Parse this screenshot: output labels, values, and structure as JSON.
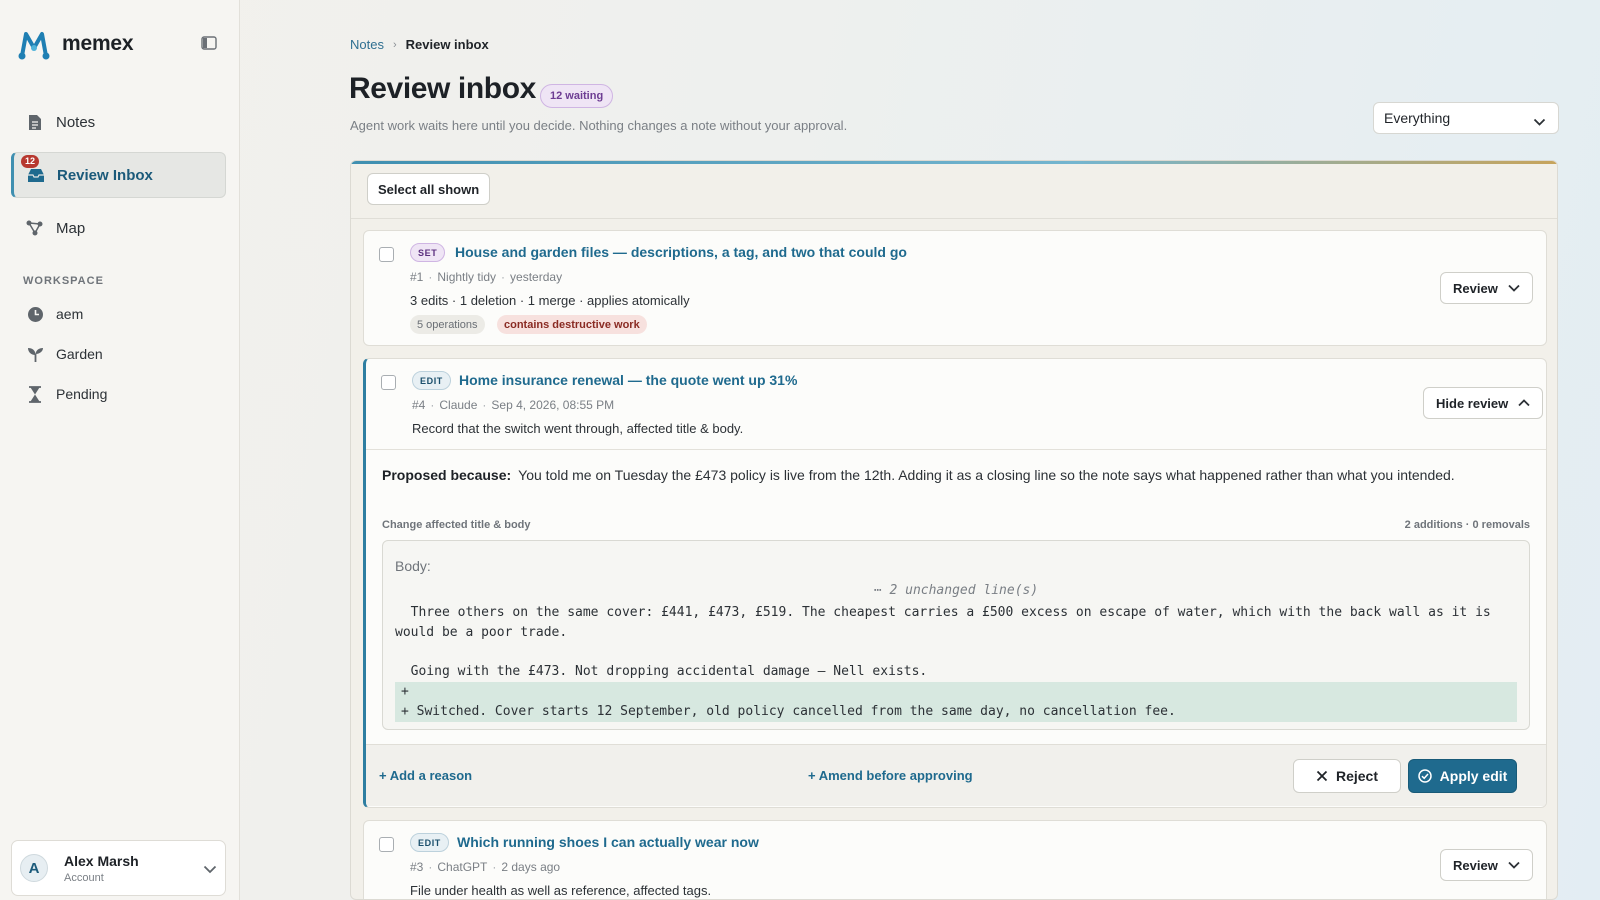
{
  "app": {
    "name": "memex"
  },
  "sidebar": {
    "nav": [
      {
        "label": "Notes",
        "icon": "document-icon"
      },
      {
        "label": "Review Inbox",
        "icon": "inbox-icon",
        "badge": "12",
        "active": true
      },
      {
        "label": "Map",
        "icon": "graph-icon"
      }
    ],
    "workspace_label": "WORKSPACE",
    "workspace": [
      {
        "label": "aem",
        "icon": "clock-icon"
      },
      {
        "label": "Garden",
        "icon": "sprout-icon"
      },
      {
        "label": "Pending",
        "icon": "hourglass-icon"
      }
    ],
    "account": {
      "initial": "A",
      "name": "Alex Marsh",
      "sub": "Account"
    }
  },
  "breadcrumb": {
    "parent": "Notes",
    "separator": "›",
    "current": "Review inbox"
  },
  "header": {
    "title": "Review inbox",
    "waiting": "12 waiting",
    "subtitle": "Agent work waits here until you decide. Nothing changes a note without your approval.",
    "filter": "Everything"
  },
  "toolbar": {
    "select_all": "Select all shown"
  },
  "cards": [
    {
      "kind": "SET",
      "title": "House and garden files — descriptions, a tag, and two that could go",
      "id": "#1",
      "source": "Nightly tidy",
      "time": "yesterday",
      "summary": "3 edits · 1 deletion · 1 merge · applies atomically",
      "tags": [
        "5 operations",
        "contains destructive work"
      ],
      "action": "Review"
    },
    {
      "kind": "EDIT",
      "title": "Home insurance renewal — the quote went up 31%",
      "id": "#4",
      "source": "Claude",
      "time": "Sep 4, 2026, 08:55 PM",
      "summary": "Record that the switch went through, affected title & body.",
      "action": "Hide review",
      "reason_label": "Proposed because:",
      "reason": "You told me on Tuesday the £473 policy is live from the 12th. Adding it as a closing line so the note says what happened rather than what you intended.",
      "change_label": "Change affected title & body",
      "change_count": "2 additions · 0 removals",
      "diff": {
        "head": "Body:",
        "unchanged": "⋯ 2 unchanged line(s)",
        "ctx1": "  Three others on the same cover: £441, £473, £519. The cheapest carries a £500 excess on escape of water, which with the back wall as it is would be a poor trade.",
        "ctx2": "  Going with the £473. Not dropping accidental damage — Nell exists.",
        "add1": "+",
        "add2": "+ Switched. Cover starts 12 September, old policy cancelled from the same day, no cancellation fee."
      },
      "footer": {
        "add_reason": "+ Add a reason",
        "amend": "+ Amend before approving",
        "reject": "Reject",
        "apply": "Apply edit"
      }
    },
    {
      "kind": "EDIT",
      "title": "Which running shoes I can actually wear now",
      "id": "#3",
      "source": "ChatGPT",
      "time": "2 days ago",
      "summary": "File under health as well as reference, affected tags.",
      "action": "Review"
    }
  ],
  "colors": {
    "accent": "#1f6a8e",
    "destructive": "#b7382f",
    "set_pill": "#efe5f5",
    "diff_add_bg": "#d7e8e0"
  }
}
